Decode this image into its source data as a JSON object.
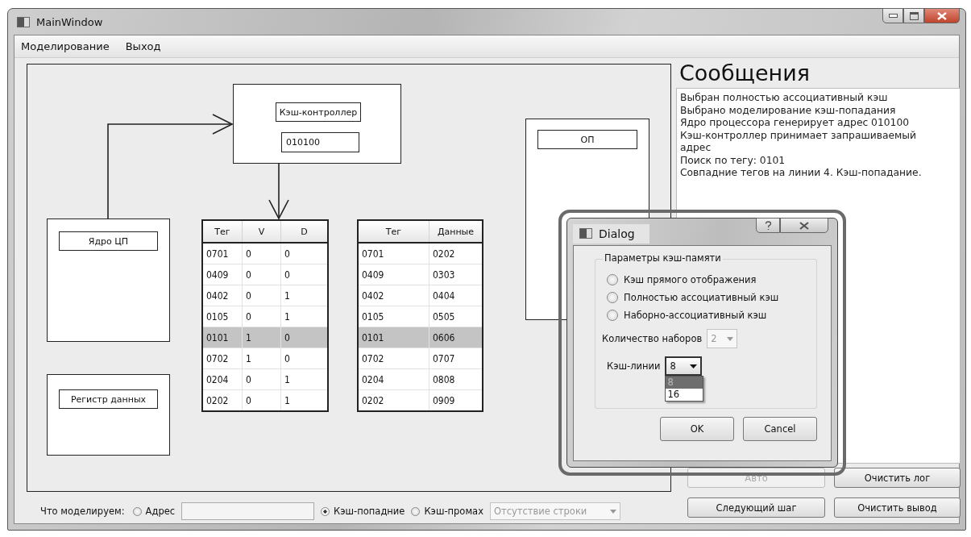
{
  "window": {
    "title": "MainWindow"
  },
  "menu": [
    {
      "label": "Моделирование"
    },
    {
      "label": "Выход"
    }
  ],
  "diagram": {
    "cache_controller": {
      "label": "Кэш-контроллер",
      "address": "010100"
    },
    "memory": {
      "label": "ОП"
    },
    "cpu_core": {
      "label": "Ядро ЦП"
    },
    "data_register": {
      "label": "Регистр данных"
    },
    "tag_table": {
      "columns": [
        "Тег",
        "V",
        "D"
      ],
      "rows": [
        {
          "cells": [
            "0701",
            "0",
            "0"
          ],
          "selected": false
        },
        {
          "cells": [
            "0409",
            "0",
            "0"
          ],
          "selected": false
        },
        {
          "cells": [
            "0402",
            "0",
            "1"
          ],
          "selected": false
        },
        {
          "cells": [
            "0105",
            "0",
            "1"
          ],
          "selected": false
        },
        {
          "cells": [
            "0101",
            "1",
            "0"
          ],
          "selected": true
        },
        {
          "cells": [
            "0702",
            "1",
            "0"
          ],
          "selected": false
        },
        {
          "cells": [
            "0204",
            "0",
            "1"
          ],
          "selected": false
        },
        {
          "cells": [
            "0202",
            "0",
            "1"
          ],
          "selected": false
        }
      ]
    },
    "data_table": {
      "columns": [
        "Тег",
        "Данные"
      ],
      "rows": [
        {
          "cells": [
            "0701",
            "0202"
          ],
          "selected": false
        },
        {
          "cells": [
            "0409",
            "0303"
          ],
          "selected": false
        },
        {
          "cells": [
            "0402",
            "0404"
          ],
          "selected": false
        },
        {
          "cells": [
            "0105",
            "0505"
          ],
          "selected": false
        },
        {
          "cells": [
            "0101",
            "0606"
          ],
          "selected": true
        },
        {
          "cells": [
            "0702",
            "0707"
          ],
          "selected": false
        },
        {
          "cells": [
            "0204",
            "0808"
          ],
          "selected": false
        },
        {
          "cells": [
            "0202",
            "0909"
          ],
          "selected": false
        }
      ]
    }
  },
  "messages": {
    "title": "Сообщения",
    "lines": [
      "Выбран полностью ассоциативный кэш",
      "Выбрано моделирование кэш-попадания",
      "Ядро процессора генерирует адрес 010100",
      "Кэш-контроллер принимает запрашиваемый адрес",
      "Поиск по тегу: 0101",
      "Совпадние тегов на линии 4. Кэш-попадание."
    ]
  },
  "buttons": [
    {
      "label": "Авто",
      "disabled": true
    },
    {
      "label": "Очистить лог",
      "disabled": false
    },
    {
      "label": "Следующий шаг",
      "disabled": false
    },
    {
      "label": "Очистить вывод",
      "disabled": false
    }
  ],
  "mode_bar": [
    {
      "kind": "label",
      "text": "Что моделируем:"
    },
    {
      "kind": "radio",
      "label": "Адрес",
      "selected": false
    },
    {
      "kind": "field"
    },
    {
      "kind": "radio",
      "label": "Кэш-попадние",
      "selected": true
    },
    {
      "kind": "radio",
      "label": "Кэш-промах",
      "selected": false
    },
    {
      "kind": "combo",
      "value": "Отсутствие строки",
      "disabled": true
    }
  ],
  "dialog": {
    "title": "Dialog",
    "group": "Параметры кэш-памяти",
    "options": [
      {
        "label": "Кэш прямого отображения",
        "selected": false
      },
      {
        "label": "Полностью ассоциативный кэш",
        "selected": false
      },
      {
        "label": "Наборно-ассоциативный кэш",
        "selected": false
      }
    ],
    "sets": {
      "label": "Количество наборов",
      "value": "2",
      "disabled": true
    },
    "lines": {
      "label": "Кэш-линии",
      "value": "8",
      "disabled": false,
      "items": [
        {
          "label": "8",
          "selected": true
        },
        {
          "label": "16",
          "selected": false
        }
      ]
    },
    "buttons": [
      "OK",
      "Cancel"
    ]
  }
}
